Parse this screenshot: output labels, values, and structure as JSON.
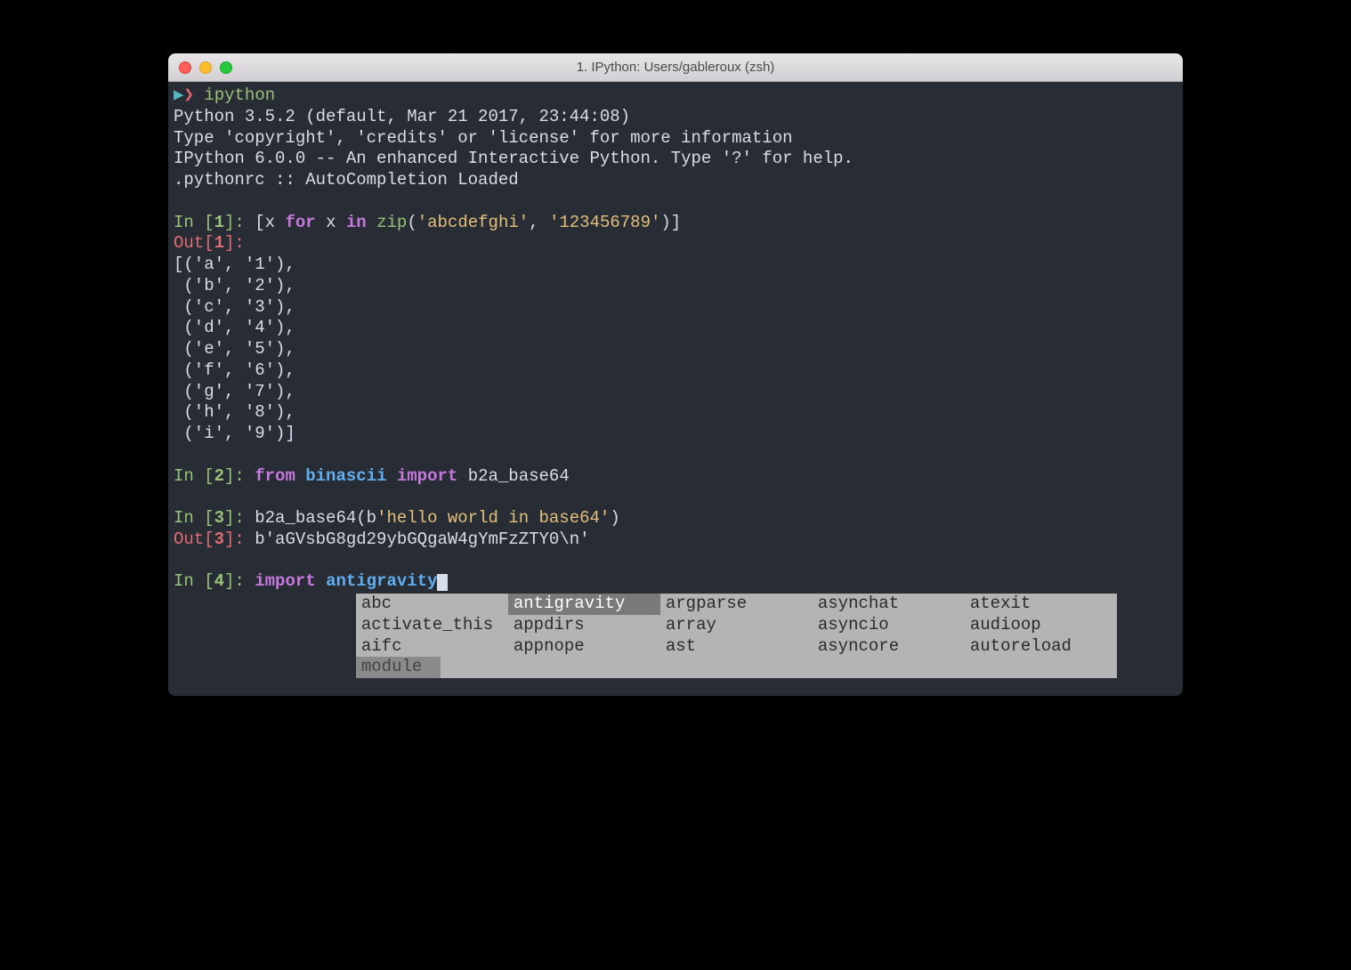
{
  "window": {
    "title": "1. IPython: Users/gableroux (zsh)"
  },
  "shell_prompt": {
    "arrow": "▶",
    "angle": "❯",
    "command": "ipython"
  },
  "banner": {
    "line1": "Python 3.5.2 (default, Mar 21 2017, 23:44:08)",
    "line2": "Type 'copyright', 'credits' or 'license' for more information",
    "line3": "IPython 6.0.0 -- An enhanced Interactive Python. Type '?' for help.",
    "line4": ".pythonrc :: AutoCompletion Loaded"
  },
  "cell1": {
    "in_label": "In [",
    "in_num": "1",
    "in_close": "]: ",
    "code_prefix": "[x ",
    "code_for": "for",
    "code_mid1": " x ",
    "code_in": "in",
    "code_mid2": " ",
    "code_zip": "zip",
    "code_paren": "(",
    "code_str1": "'abcdefghi'",
    "code_comma": ", ",
    "code_str2": "'123456789'",
    "code_end": ")]",
    "out_label": "Out[",
    "out_num": "1",
    "out_close": "]:",
    "output": [
      "[('a', '1'),",
      " ('b', '2'),",
      " ('c', '3'),",
      " ('d', '4'),",
      " ('e', '5'),",
      " ('f', '6'),",
      " ('g', '7'),",
      " ('h', '8'),",
      " ('i', '9')]"
    ]
  },
  "cell2": {
    "in_label": "In [",
    "in_num": "2",
    "in_close": "]: ",
    "from": "from",
    "module": "binascii",
    "import": "import",
    "name": " b2a_base64"
  },
  "cell3": {
    "in_label": "In [",
    "in_num": "3",
    "in_close": "]: ",
    "func": "b2a_base64(",
    "arg_prefix": "b",
    "arg_str": "'hello world in base64'",
    "close": ")",
    "out_label": "Out[",
    "out_num": "3",
    "out_close": "]: ",
    "output": "b'aGVsbG8gd29ybGQgaW4gYmFzZTY0\\n'"
  },
  "cell4": {
    "in_label": "In [",
    "in_num": "4",
    "in_close": "]: ",
    "import": "import",
    "module": "antigravity"
  },
  "autocomplete": {
    "selected": "antigravity",
    "columns": [
      [
        "abc",
        "activate_this",
        "aifc"
      ],
      [
        "antigravity",
        "appdirs",
        "appnope"
      ],
      [
        "argparse",
        "array",
        "ast"
      ],
      [
        "asynchat",
        "asyncio",
        "asyncore"
      ],
      [
        "atexit",
        "audioop",
        "autoreload"
      ]
    ],
    "statusbar": "module"
  }
}
